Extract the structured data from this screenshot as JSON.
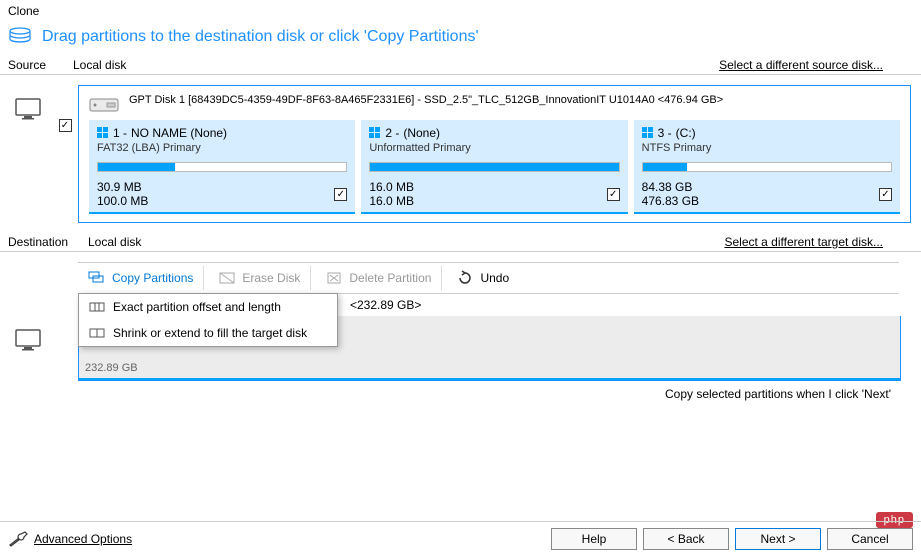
{
  "title": "Clone",
  "instruction": "Drag partitions to the destination disk or click 'Copy Partitions'",
  "source": {
    "label": "Source",
    "sub": "Local disk",
    "diff_link": "Select a different source disk...",
    "disk_header": "GPT Disk 1 [68439DC5-4359-49DF-8F63-8A465F2331E6] - SSD_2.5\"_TLC_512GB_InnovationIT U1014A0  <476.94 GB>",
    "partitions": [
      {
        "num": "1 -",
        "name": "NO NAME  (None)",
        "sub": "FAT32 (LBA) Primary",
        "used": "30.9 MB",
        "total": "100.0 MB",
        "fill": 31
      },
      {
        "num": "2 -",
        "name": "  (None)",
        "sub": "Unformatted Primary",
        "used": "16.0 MB",
        "total": "16.0 MB",
        "fill": 100
      },
      {
        "num": "3 -",
        "name": "  (C:)",
        "sub": "NTFS Primary",
        "used": "84.38 GB",
        "total": "476.83 GB",
        "fill": 18
      }
    ]
  },
  "destination": {
    "label": "Destination",
    "sub": "Local disk",
    "diff_link": "Select a different target disk...",
    "toolbar": {
      "copy": "Copy Partitions",
      "erase": "Erase Disk",
      "delete": "Delete Partition",
      "undo": "Undo"
    },
    "dropdown": {
      "exact": "Exact partition offset and length",
      "shrink": "Shrink or extend to fill the target disk"
    },
    "target_header": "<232.89 GB>",
    "unallocated": "232.89 GB"
  },
  "copy_selected": "Copy selected partitions when I click 'Next'",
  "footer": {
    "advanced": "Advanced Options",
    "help": "Help",
    "back": "< Back",
    "next": "Next >",
    "cancel": "Cancel"
  },
  "brand": "php"
}
